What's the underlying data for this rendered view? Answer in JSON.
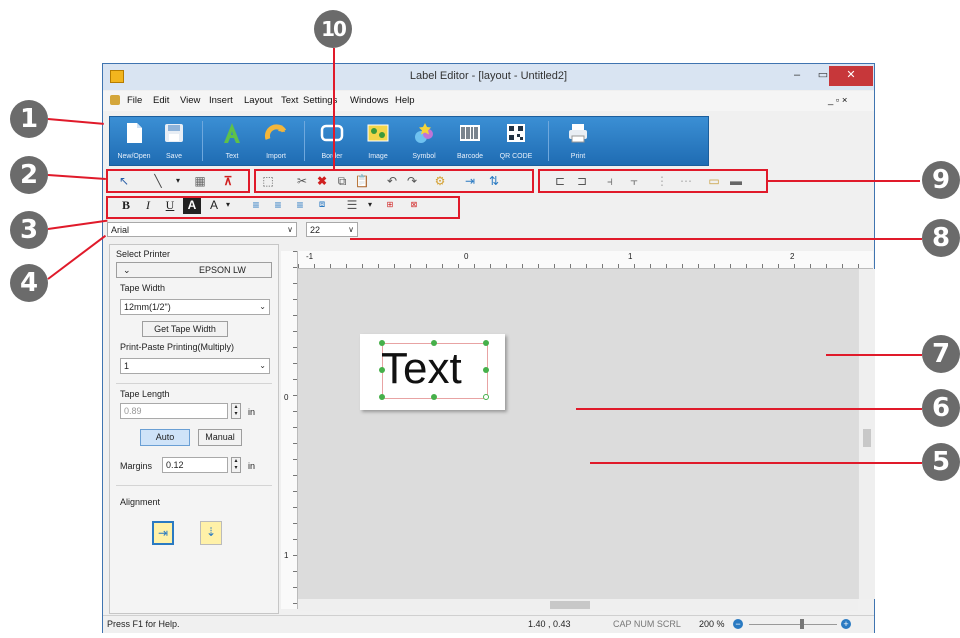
{
  "window": {
    "title": "Label Editor - [layout - Untitled2]",
    "minimize": "–",
    "maximize": "▭",
    "close": "✕",
    "mdi_controls": "_ ▫ ×"
  },
  "menu": [
    "File",
    "Edit",
    "View",
    "Insert",
    "Layout",
    "Text",
    "Settings",
    "Windows",
    "Help"
  ],
  "ribbon": [
    "New/Open",
    "Save",
    "Text",
    "Import",
    "Border",
    "Image",
    "Symbol",
    "Barcode",
    "QR CODE",
    "Print"
  ],
  "font": {
    "name": "Arial",
    "size": "22"
  },
  "panel": {
    "select_printer": "Select Printer",
    "printer_name": "EPSON LW",
    "tape_width_label": "Tape Width",
    "tape_width_value": "12mm(1/2\")",
    "get_tape_width": "Get Tape Width",
    "print_paste_label": "Print-Paste Printing(Multiply)",
    "print_paste_value": "1",
    "tape_length_label": "Tape Length",
    "tape_length_value": "0.89",
    "unit": "in",
    "auto": "Auto",
    "manual": "Manual",
    "margins_label": "Margins",
    "margins_value": "0.12",
    "alignment_label": "Alignment"
  },
  "ruler": {
    "h_marks": [
      "-1",
      "0",
      "1",
      "2"
    ],
    "v_marks": [
      "0",
      "1"
    ]
  },
  "label_text": "Text",
  "status": {
    "help": "Press F1 for Help.",
    "coords": "1.40 , 0.43",
    "indicators": "CAP  NUM  SCRL",
    "zoom": "200 %"
  },
  "callouts": [
    "1",
    "2",
    "3",
    "4",
    "5",
    "6",
    "7",
    "8",
    "9",
    "10"
  ],
  "colors": {
    "callout": "#6b6b6b",
    "highlight": "#e01a2a",
    "ribbon": "#2a7ac2"
  }
}
